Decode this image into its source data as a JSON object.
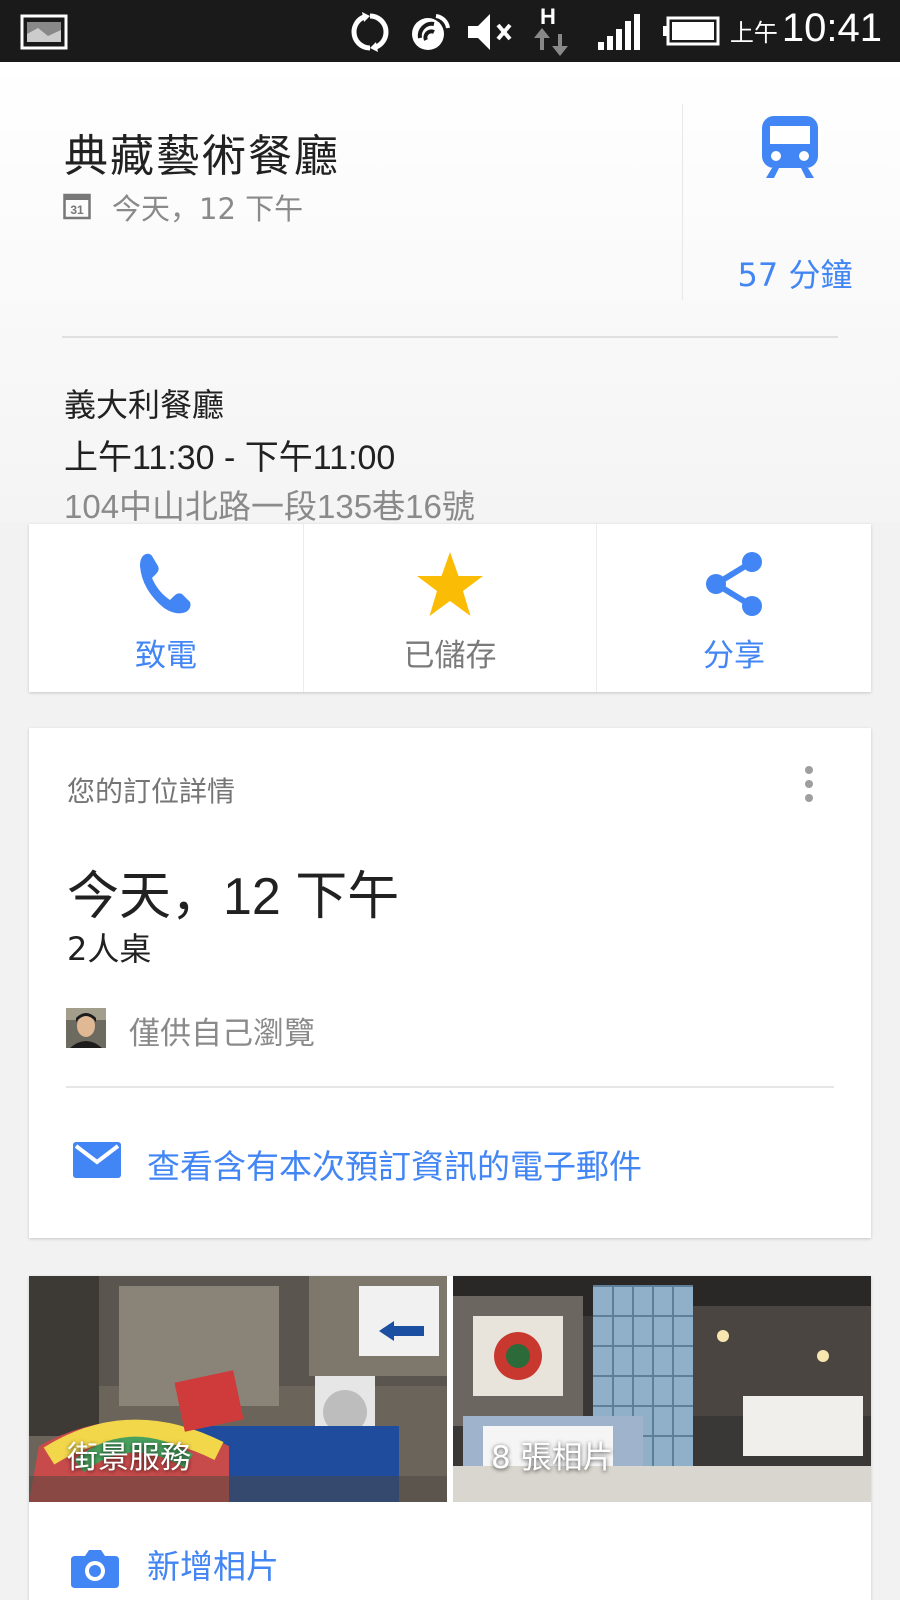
{
  "status_bar": {
    "ampm": "上午",
    "time": "10:41",
    "icons": [
      "gallery-icon",
      "sync-icon",
      "nfc-icon",
      "mute-icon",
      "data-h-icon",
      "signal-icon",
      "battery-icon"
    ]
  },
  "place": {
    "name": "典藏藝術餐廳",
    "calendar_day": "31",
    "date_line": "今天，12 下午",
    "category": "義大利餐廳",
    "hours": "上午11:30 - 下午11:00",
    "address": "104中山北路一段135巷16號"
  },
  "transit": {
    "icon": "train-icon",
    "duration": "57 分鐘"
  },
  "actions": {
    "call_label": "致電",
    "saved_label": "已儲存",
    "share_label": "分享"
  },
  "reservation": {
    "heading": "您的訂位詳情",
    "date": "今天，12 下午",
    "party": "2人桌",
    "visibility": "僅供自己瀏覽",
    "email_link": "查看含有本次預訂資訊的電子郵件"
  },
  "photos": {
    "street_view_label": "街景服務",
    "photo_count_label": "8 張相片",
    "add_photo_label": "新增相片"
  },
  "colors": {
    "accent": "#4285f4",
    "star": "#fbbc05",
    "status_bar": "#1a1a1a"
  }
}
